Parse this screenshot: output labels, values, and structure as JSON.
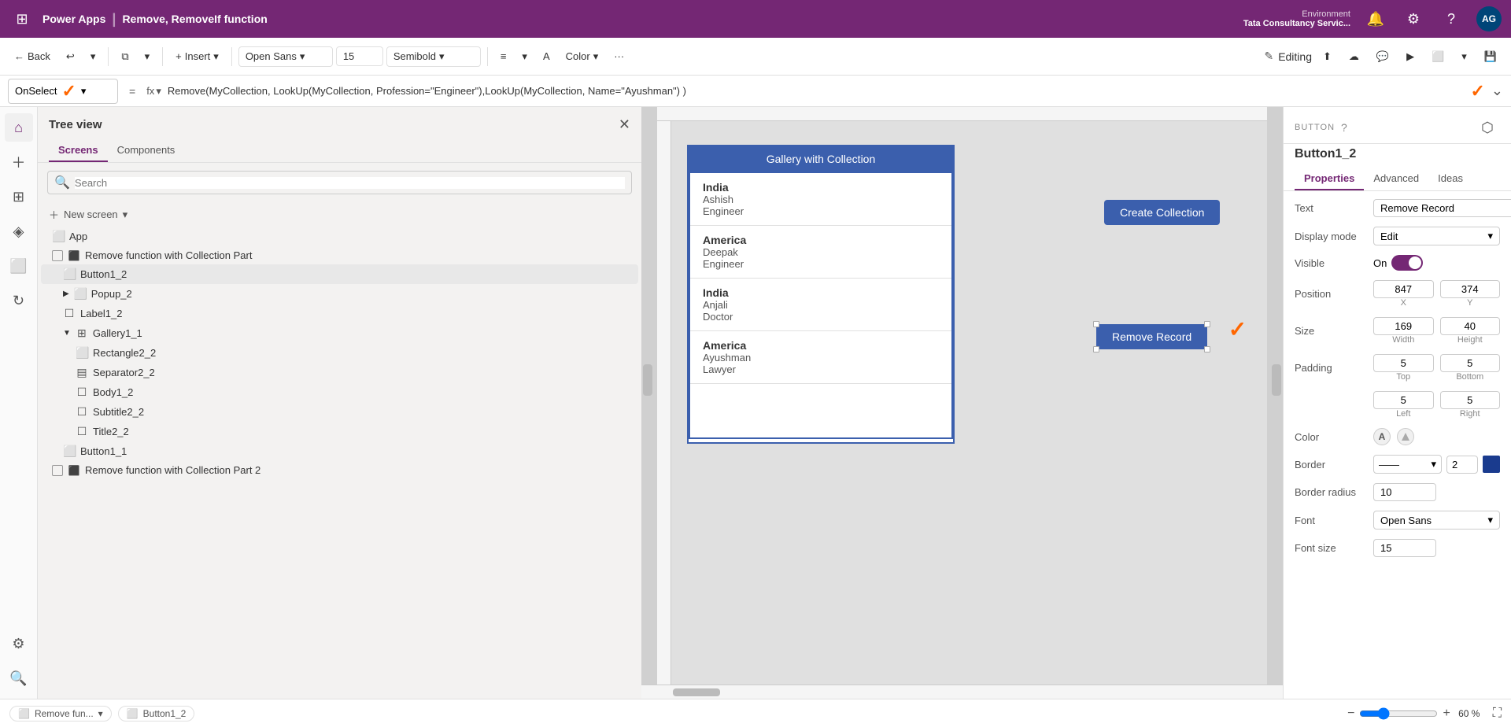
{
  "app": {
    "name": "Power Apps",
    "separator": "|",
    "title": "Remove, RemoveIf function"
  },
  "environment": {
    "label": "Environment",
    "name": "Tata Consultancy Servic..."
  },
  "topbar": {
    "back_label": "Back",
    "insert_label": "Insert",
    "color_label": "Color",
    "editing_label": "Editing",
    "avatar_text": "AG"
  },
  "toolbar": {
    "font": "Open Sans",
    "font_size": "15",
    "font_weight": "Semibold"
  },
  "formula_bar": {
    "property": "OnSelect",
    "formula": "Remove(MyCollection, LookUp(MyCollection, Profession=\"Engineer\"),LookUp(MyCollection, Name=\"Ayushman\") )"
  },
  "tree_view": {
    "title": "Tree view",
    "tabs": [
      {
        "label": "Screens",
        "active": true
      },
      {
        "label": "Components",
        "active": false
      }
    ],
    "search_placeholder": "Search",
    "new_screen": "New screen",
    "items": [
      {
        "id": "app",
        "label": "App",
        "indent": 0,
        "type": "app",
        "has_checkbox": false
      },
      {
        "id": "remove-function-part1",
        "label": "Remove function with Collection Part",
        "indent": 0,
        "type": "screen",
        "has_checkbox": true
      },
      {
        "id": "button1-2",
        "label": "Button1_2",
        "indent": 1,
        "type": "button",
        "selected": true
      },
      {
        "id": "popup-2",
        "label": "Popup_2",
        "indent": 1,
        "type": "popup",
        "collapsed": true
      },
      {
        "id": "label1-2",
        "label": "Label1_2",
        "indent": 1,
        "type": "label"
      },
      {
        "id": "gallery1-1",
        "label": "Gallery1_1",
        "indent": 1,
        "type": "gallery",
        "expanded": true
      },
      {
        "id": "rectangle2-2",
        "label": "Rectangle2_2",
        "indent": 2,
        "type": "rectangle"
      },
      {
        "id": "separator2-2",
        "label": "Separator2_2",
        "indent": 2,
        "type": "separator"
      },
      {
        "id": "body1-2",
        "label": "Body1_2",
        "indent": 2,
        "type": "body"
      },
      {
        "id": "subtitle2-2",
        "label": "Subtitle2_2",
        "indent": 2,
        "type": "subtitle"
      },
      {
        "id": "title2-2",
        "label": "Title2_2",
        "indent": 2,
        "type": "title"
      },
      {
        "id": "button1-1",
        "label": "Button1_1",
        "indent": 1,
        "type": "button"
      },
      {
        "id": "remove-function-part2",
        "label": "Remove function with Collection Part 2",
        "indent": 0,
        "type": "screen",
        "has_checkbox": true
      }
    ]
  },
  "canvas": {
    "gallery_title": "Gallery with Collection",
    "items": [
      {
        "country": "India",
        "name": "Ashish",
        "profession": "Engineer"
      },
      {
        "country": "America",
        "name": "Deepak",
        "profession": "Engineer"
      },
      {
        "country": "India",
        "name": "Anjali",
        "profession": "Doctor"
      },
      {
        "country": "America",
        "name": "Ayushman",
        "profession": "Lawyer"
      }
    ],
    "create_collection_btn": "Create Collection",
    "remove_record_btn": "Remove Record"
  },
  "right_panel": {
    "type_label": "BUTTON",
    "component_name": "Button1_2",
    "tabs": [
      "Properties",
      "Advanced",
      "Ideas"
    ],
    "active_tab": "Properties",
    "properties": {
      "text_label": "Text",
      "text_value": "Remove Record",
      "display_mode_label": "Display mode",
      "display_mode_value": "Edit",
      "visible_label": "Visible",
      "visible_value": "On",
      "position_label": "Position",
      "pos_x": "847",
      "pos_y": "374",
      "pos_x_label": "X",
      "pos_y_label": "Y",
      "size_label": "Size",
      "size_width": "169",
      "size_height": "40",
      "size_width_label": "Width",
      "size_height_label": "Height",
      "padding_label": "Padding",
      "padding_top": "5",
      "padding_bottom": "5",
      "padding_top_label": "Top",
      "padding_bottom_label": "Bottom",
      "padding_left": "5",
      "padding_right": "5",
      "padding_left_label": "Left",
      "padding_right_label": "Right",
      "color_label": "Color",
      "border_label": "Border",
      "border_width": "2",
      "border_radius_label": "Border radius",
      "border_radius_value": "10",
      "font_label": "Font",
      "font_value": "Open Sans",
      "font_size_label": "Font size",
      "font_size_value": "15"
    }
  },
  "status_bar": {
    "screen_label": "Remove fun...",
    "component_label": "Button1_2",
    "zoom_minus": "−",
    "zoom_value": "60 %",
    "zoom_plus": "+"
  }
}
